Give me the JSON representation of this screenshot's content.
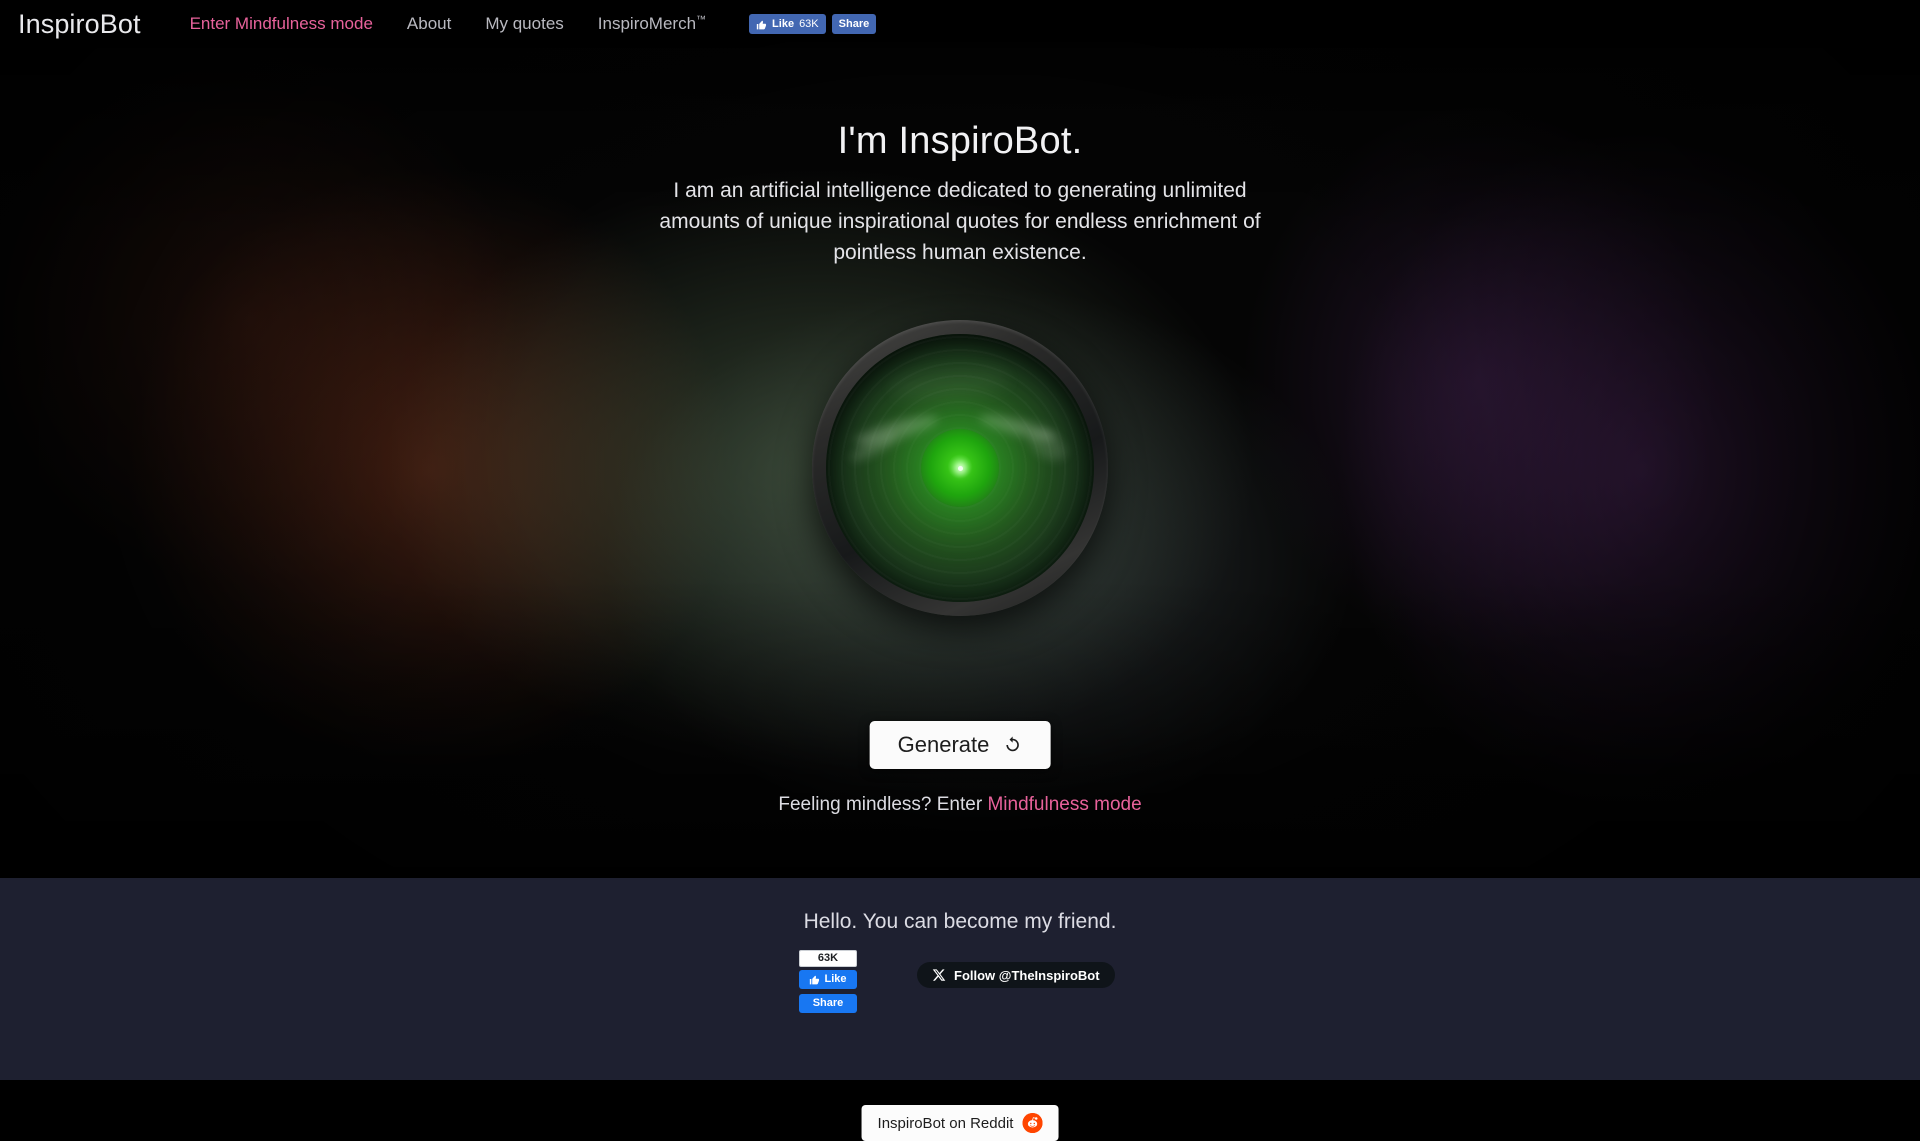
{
  "header": {
    "brand": "InspiroBot",
    "nav": [
      {
        "label": "Enter Mindfulness mode",
        "accent": true
      },
      {
        "label": "About",
        "accent": false
      },
      {
        "label": "My quotes",
        "accent": false
      },
      {
        "label": "InspiroMerch",
        "accent": false,
        "suffix": "™"
      }
    ],
    "facebook": {
      "like_label": "Like",
      "like_count": "63K",
      "share_label": "Share"
    }
  },
  "hero": {
    "title": "I'm InspiroBot.",
    "description": "I am an artificial intelligence dedicated to generating unlimited amounts of unique inspirational quotes for endless enrichment of pointless human existence.",
    "eye_icon": "hal-eye-icon"
  },
  "actions": {
    "generate_label": "Generate",
    "generate_icon": "refresh-icon",
    "mindless_prefix": "Feeling mindless? Enter ",
    "mindless_link": "Mindfulness mode"
  },
  "footer": {
    "title": "Hello. You can become my friend.",
    "facebook": {
      "count": "63K",
      "like_label": "Like",
      "share_label": "Share"
    },
    "twitter": {
      "label": "Follow @TheInspiroBot",
      "icon": "x-logo-icon"
    },
    "reddit": {
      "label": "InspiroBot on Reddit",
      "icon": "reddit-logo-icon"
    }
  },
  "colors": {
    "accent_pink": "#e8629b",
    "facebook_blue": "#1877f2",
    "facebook_blue_dark": "#4267b2",
    "reddit_orange": "#ff4500",
    "footer_bg": "#1e2030",
    "eye_green": "#2ebe1e"
  }
}
